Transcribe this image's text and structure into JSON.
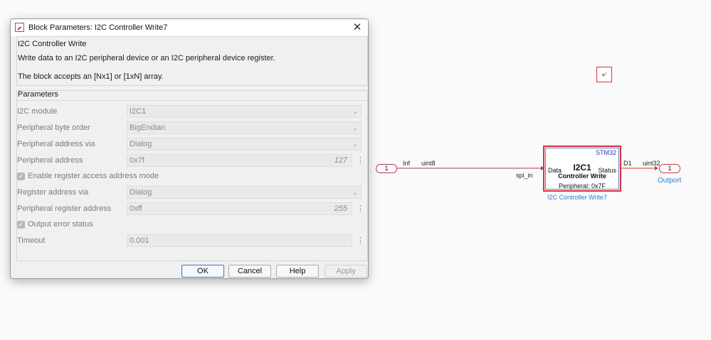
{
  "dialog": {
    "title": "Block Parameters: I2C Controller Write7",
    "close_symbol": "✕",
    "description_title": "I2C Controller Write",
    "description_line1": "Write data to an I2C peripheral device or an I2C peripheral device register.",
    "description_line2": "The block accepts an [Nx1] or [1xN] array.",
    "params_title": "Parameters",
    "params": {
      "i2c_module": {
        "label": "I2C module",
        "value": "I2C1"
      },
      "byte_order": {
        "label": "Peripheral byte order",
        "value": "BigEndian"
      },
      "addr_via": {
        "label": "Peripheral address via",
        "value": "Dialog"
      },
      "peripheral_address": {
        "label": "Peripheral address",
        "value": "0x7f",
        "display": "127"
      },
      "enable_reg": {
        "label": "Enable register access address mode",
        "checked": true
      },
      "reg_addr_via": {
        "label": "Register address via",
        "value": "Dialog"
      },
      "periph_reg_addr": {
        "label": "Peripheral register address",
        "value": "0xff",
        "display": "255"
      },
      "output_error": {
        "label": "Output error status",
        "checked": true
      },
      "timeout": {
        "label": "Timeout",
        "value": "0.001"
      }
    },
    "buttons": {
      "ok": "OK",
      "cancel": "Cancel",
      "help": "Help",
      "apply": "Apply"
    },
    "dots": "⋮",
    "check_mark": "✓",
    "chevron": "⌄"
  },
  "canvas": {
    "inport": {
      "number": "1",
      "signal_inf": "Inf",
      "signal_type": "uint8",
      "signal_name": "spi_in"
    },
    "block": {
      "target": "STM32",
      "name": "I2C1",
      "subtitle": "Controller Write",
      "peripheral": "Peripheral: 0x7F",
      "in_port": "Data",
      "out_port": "Status",
      "label": "I2C Controller Write7"
    },
    "outport": {
      "number": "1",
      "signal_name": "D1",
      "signal_type": "uint32",
      "label": "Outport"
    },
    "run_icon_symbol": "⤶"
  },
  "colors": {
    "signal_in": "#b0316a",
    "signal_out": "#d8363c",
    "block_border": "#d62e44",
    "label_blue": "#2a7fd4",
    "target_text": "#2738a8"
  }
}
